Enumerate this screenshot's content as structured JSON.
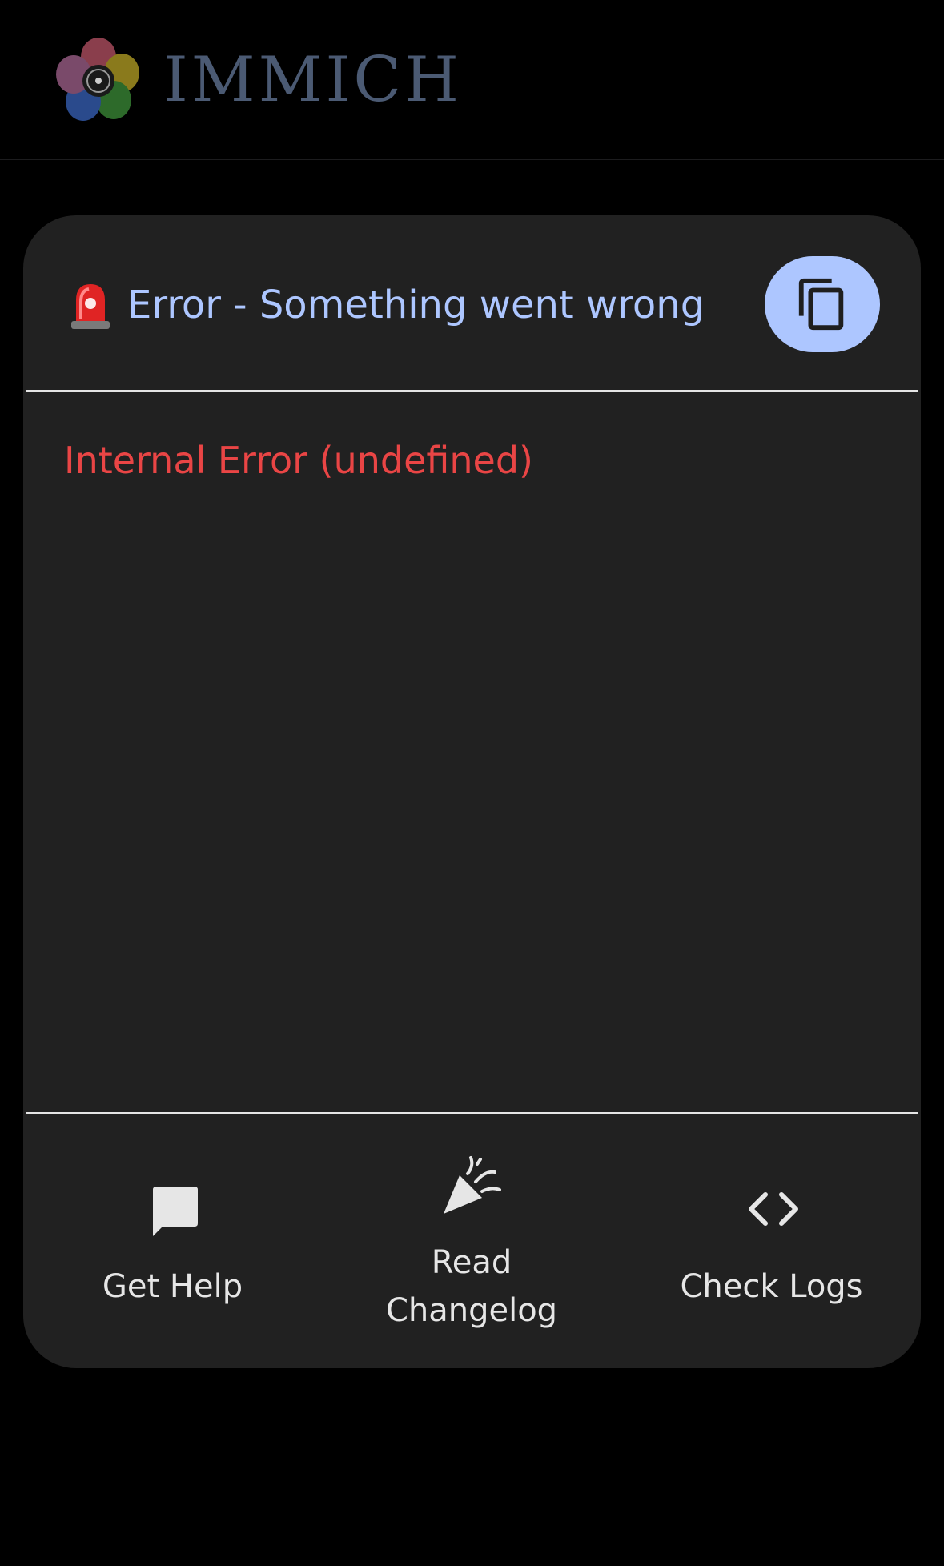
{
  "header": {
    "logo_text": "IMMICH",
    "logo_icon": "immich-flower-icon"
  },
  "error_card": {
    "title": "Error - Something went wrong",
    "title_icon": "siren-icon",
    "copy_icon": "copy-icon",
    "message": "Internal Error (undefined)",
    "actions": [
      {
        "label": "Get Help",
        "icon": "chat-bubble-icon"
      },
      {
        "label": "Read Changelog",
        "icon": "party-popper-icon"
      },
      {
        "label": "Check Logs",
        "icon": "code-brackets-icon"
      }
    ]
  },
  "colors": {
    "background": "#000000",
    "card": "#212121",
    "title": "#adc6ff",
    "error": "#e94545",
    "action_text": "#e6e6e6",
    "logo_text": "#4b5a73"
  }
}
